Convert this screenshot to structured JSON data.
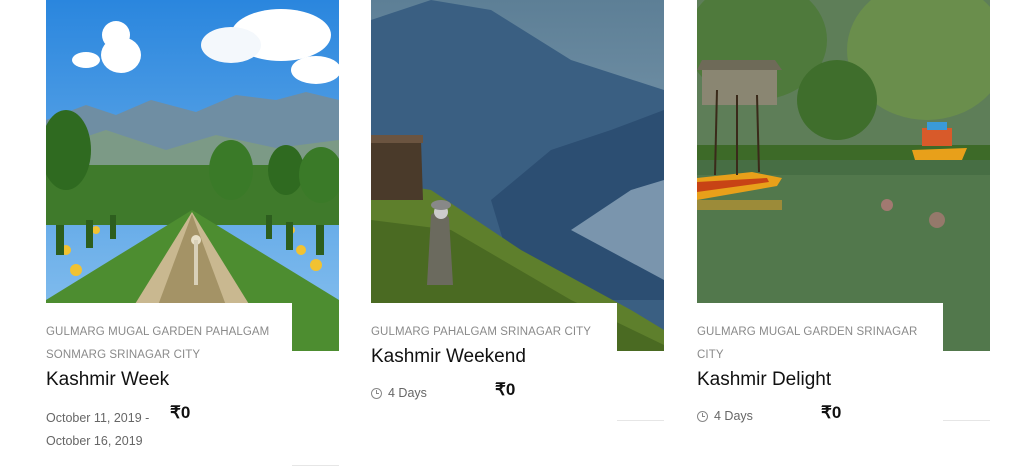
{
  "cards": [
    {
      "locations": "GULMARG MUGAL GARDEN PAHALGAM SONMARG SRINAGAR CITY",
      "title": "Kashmir Week",
      "dates": "October 11, 2019 - October 16, 2019",
      "price": "₹0",
      "image_icon": "garden-mountains-image"
    },
    {
      "locations": "GULMARG PAHALGAM SRINAGAR CITY",
      "title": "Kashmir Weekend",
      "duration": "4 Days",
      "price": "₹0",
      "image_icon": "valley-hiker-image"
    },
    {
      "locations": "GULMARG MUGAL GARDEN SRINAGAR CITY",
      "title": "Kashmir Delight",
      "duration": "4 Days",
      "price": "₹0",
      "image_icon": "lake-shikara-image"
    }
  ]
}
